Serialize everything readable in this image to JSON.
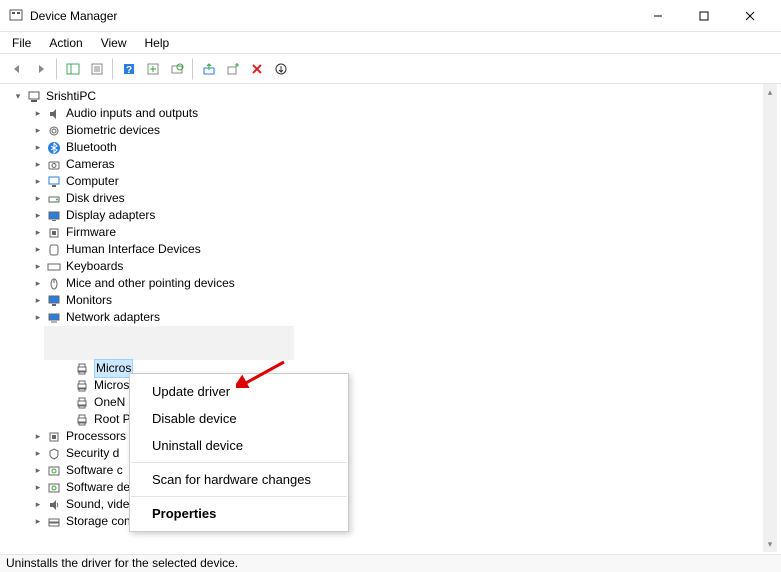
{
  "window": {
    "title": "Device Manager"
  },
  "menu": {
    "file": "File",
    "action": "Action",
    "view": "View",
    "help": "Help"
  },
  "root": {
    "name": "SrishtiPC"
  },
  "categories": [
    {
      "icon": "audio-icon",
      "label": "Audio inputs and outputs"
    },
    {
      "icon": "biometric-icon",
      "label": "Biometric devices"
    },
    {
      "icon": "bluetooth-icon",
      "label": "Bluetooth"
    },
    {
      "icon": "camera-icon",
      "label": "Cameras"
    },
    {
      "icon": "computer-icon",
      "label": "Computer"
    },
    {
      "icon": "disk-icon",
      "label": "Disk drives"
    },
    {
      "icon": "display-icon",
      "label": "Display adapters"
    },
    {
      "icon": "firmware-icon",
      "label": "Firmware"
    },
    {
      "icon": "hid-icon",
      "label": "Human Interface Devices"
    },
    {
      "icon": "keyboard-icon",
      "label": "Keyboards"
    },
    {
      "icon": "mouse-icon",
      "label": "Mice and other pointing devices"
    },
    {
      "icon": "monitor-icon",
      "label": "Monitors"
    },
    {
      "icon": "network-icon",
      "label": "Network adapters"
    }
  ],
  "print_queues": [
    {
      "label": "Micros",
      "selected": true
    },
    {
      "label": "Micros",
      "selected": false
    },
    {
      "label": "OneN",
      "selected": false
    },
    {
      "label": "Root P",
      "selected": false
    }
  ],
  "categories_after": [
    {
      "icon": "processor-icon",
      "label": "Processors"
    },
    {
      "icon": "security-icon",
      "label": "Security d"
    },
    {
      "icon": "software-icon",
      "label": "Software c"
    },
    {
      "icon": "software-icon",
      "label": "Software de"
    },
    {
      "icon": "sound-icon",
      "label": "Sound, video and game controllers"
    },
    {
      "icon": "storage-icon",
      "label": "Storage controllers"
    }
  ],
  "context_menu": {
    "update": "Update driver",
    "disable": "Disable device",
    "uninstall": "Uninstall device",
    "scan": "Scan for hardware changes",
    "properties": "Properties"
  },
  "status": "Uninstalls the driver for the selected device."
}
